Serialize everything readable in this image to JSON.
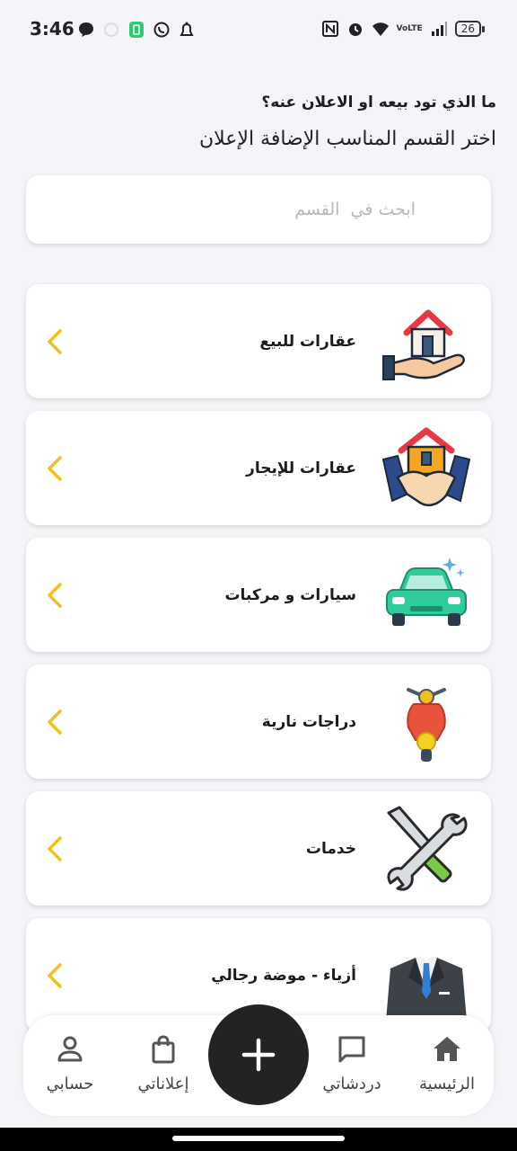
{
  "status_bar": {
    "time": "3:46",
    "battery": "26",
    "network": "VoLTE"
  },
  "header": {
    "question": "ما الذي تود بيعه او الاعلان عنه؟",
    "subtitle": "اختر القسم المناسب الإضافة الإعلان"
  },
  "search": {
    "placeholder": "ابحث في  القسم",
    "value": ""
  },
  "categories": [
    {
      "label": "عقارات للبيع",
      "icon": "house-in-hand-icon"
    },
    {
      "label": "عقارات للإيجار",
      "icon": "house-handshake-icon"
    },
    {
      "label": "سيارات و مركبات",
      "icon": "car-icon"
    },
    {
      "label": "دراجات نارية",
      "icon": "scooter-icon"
    },
    {
      "label": "خدمات",
      "icon": "wrench-screwdriver-icon"
    },
    {
      "label": "أزياء - موضة رجالي",
      "icon": "suit-icon"
    }
  ],
  "bottom_nav": {
    "home": "الرئيسية",
    "chats": "دردشاتي",
    "my_ads": "إعلاناتي",
    "account": "حسابي"
  },
  "colors": {
    "accent": "#f2c01d",
    "fab": "#232323",
    "background": "#f4f5f8"
  }
}
